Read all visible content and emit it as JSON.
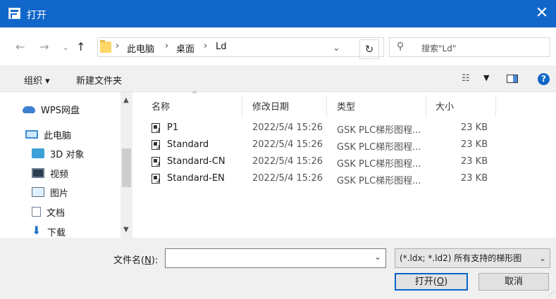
{
  "window": {
    "title": "打开",
    "close_glyph": "✕"
  },
  "navigation": {
    "back": "←",
    "forward": "→",
    "recent": "⌄",
    "up": "↑"
  },
  "address": {
    "sep": "›",
    "crumbs": [
      "此电脑",
      "桌面",
      "Ld"
    ],
    "dropdown": "⌄",
    "refresh": "↻"
  },
  "search": {
    "placeholder": "搜索\"Ld\"",
    "icon": "⚲"
  },
  "toolbar": {
    "organize": "组织 ▾",
    "new_folder": "新建文件夹",
    "view_icon": "☷",
    "view_dropdown": "▼",
    "help": "?"
  },
  "sidebar": {
    "items": [
      {
        "label": "WPS网盘",
        "icon": "cloud-icon"
      },
      {
        "label": "此电脑",
        "icon": "computer-icon"
      },
      {
        "label": "3D 对象",
        "icon": "3d-objects-icon"
      },
      {
        "label": "视频",
        "icon": "video-icon"
      },
      {
        "label": "图片",
        "icon": "pictures-icon"
      },
      {
        "label": "文档",
        "icon": "documents-icon"
      },
      {
        "label": "下载",
        "icon": "downloads-icon"
      }
    ],
    "scroll_up": "▲",
    "scroll_down": "▼"
  },
  "file_list": {
    "columns": [
      "名称",
      "修改日期",
      "类型",
      "大小"
    ],
    "sort_caret": "^",
    "rows": [
      {
        "name": "P1",
        "date": "2022/5/4 15:26",
        "type": "GSK PLC梯形图程...",
        "size": "23 KB"
      },
      {
        "name": "Standard",
        "date": "2022/5/4 15:26",
        "type": "GSK PLC梯形图程...",
        "size": "23 KB"
      },
      {
        "name": "Standard-CN",
        "date": "2022/5/4 15:26",
        "type": "GSK PLC梯形图程...",
        "size": "23 KB"
      },
      {
        "name": "Standard-EN",
        "date": "2022/5/4 15:26",
        "type": "GSK PLC梯形图程...",
        "size": "23 KB"
      }
    ]
  },
  "footer": {
    "filename_label_pre": "文件名(",
    "filename_label_key": "N",
    "filename_label_post": "):",
    "filename_value": "",
    "dropdown": "⌄",
    "filter": "(*.ldx; *.ld2) 所有支持的梯形图",
    "open_pre": "打开(",
    "open_key": "O",
    "open_post": ")",
    "cancel": "取消",
    "grip": "⋰"
  }
}
